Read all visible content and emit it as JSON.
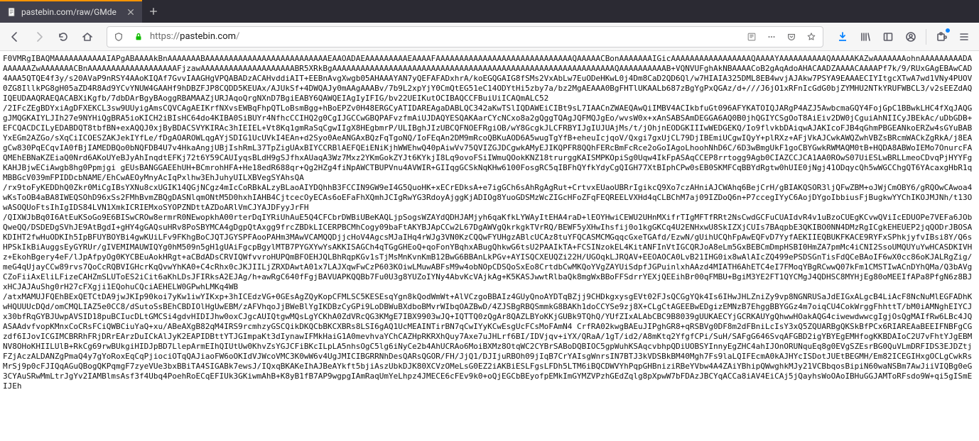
{
  "tab": {
    "title": "pastebin.com/raw/GMde"
  },
  "url": {
    "protocol": "https://",
    "host": "pastebin.com",
    "path": "/"
  },
  "colors": {
    "tab_highlight": "#ff9400",
    "lock_green": "#12bc00",
    "download_blue": "#0a84ff"
  },
  "content": {
    "raw": "F0VMRgIBAQMAAAAAAAAAAAIAPgABAAAAkBnAAAAAAABAAAAAAAAAAAAAAAAAAAAAAAAAAEAAOADAEAAAAAAAAAEAAAAFAAAAAAAAAAAAAAAAAAAAAAAAAAAAAQAAAAACBonAAAAAAAIGicAAAAAAAAAAAAAAAAAQAAAAYAAAAAAAAAAQAAAAAKAZwAAAAAAAohnAAAAAAAAADAAAAAAAZwAAAAAAACBnAAAAAAAAAAAAAAAAAAAFjzawAAAAAAAAAAAAAAAAAAAABR5XRkBgAAAAAAAAAAAAAAAAAAAAAAAAAAAAAAAAAAAAAAAAAAAAAAAAAAAAAAAAAAAAQAAAAAAAAAAB+VQNVUFghAkNBAAAACoB2gAqAdoAHACAADZAAAACAAAAPf7k/9/RUxGAgEBAwCAD4AAA5QTQE4f3y/s20AVaP9nRSY4AAoKIQAf7GvvIAAGHgVPQABADzACAHvddiAIT+EEBnAvgXwgb05AHAAAYAN7yQEFAFADxhrA/koEGQGAIG8fSMs2VxAbLw7EuODeHKwL0j4Dm8CaD2QD6Ql/w7HIAIA325DML8EB4wvjAJAkw7PSYA9EAAAECIYItgcXTwA7wd1VNy4PUOV0ZG8IllkPG8gH05aZD4R8Ad9YCvYNUW4GAAHf9hDBZFJP8CQDD5KEUAx/AJUkSf+4DWQAJy0mAAgAAABv/7b9L2xpYjY0CmQtEG51eC14ODYtHi5zby7a/bz2MgAEAAA0BgFHTlUKAALb687zBgYgPxQGAz/d+///J6jO1xRFnIcGdG0bjZYMHU2NTkYRUFWBCL3/v2sEEZdAQIQEUDAAQRAEQACABXiKgfb/7dbDArBgyBAoggRBAMAAZjURJAqoQrgNXnD7BgiEABY6QAWQEIAgIyIFIG/bv22UEIKutOCIBAQCCFBuiUiICAQmALC52\n/2IFcZEgBDYxiAgDFXEKCL3sw9UUyigAmsCQVCAgAEIKrfNXvsEWBqFhpQTLoBsmBgg+hBoEPZv0H48ERGCyATIDAREAgaDABLQC342aKwTSlIQDAWEiCIBt9sL7IAACnZWAEQAwQiIMBV4ACIkbfuGt096AFYKATOIQJARgP4AZJ5AwbcmaGQY4FojGpC1BBwkLHC4fXqJAQGgJMQGKAIYLJIh27e9NYHiQgBRA5ioKICH2iBIsHC64do4KIBA0SiBUYr4NfhcCCIHQ2g0CgIJGCCwGBQPAFvzfmAiUJDAQYESQAKAarCYcNCxo8a2gQggTQAgJQFMQJgEo/wvsW0x+xAnSABSAmDEGGA6AQ0B0jhQGIYCSgOoT8AiEiv2DW0jCguiAhNIICyJBEkAc/uDbGDB+EFCQACDCILyEDABDQT8tbfBN+exAQQJ0xjByBDACSVYKIRAc3hIEIEL+Vt8Kq1gmRaSqCgwIIgX8HEgbmrP/ULIBghJIzUBCQFNOEFRgiOB/wY8GcgkJLCFRBYIJgIUJUAjMs/t/jOhjnEODGKIIIwWEDGEKQ/Io9flvkbDAiqwAJAKIcoFJB4qGhmPBGEANkoERZw4sGYuBABYxEGm2AZGo/sXqCiICOESZAKJekIYfLe/fDgAOAROWLqgAYjSDIG1UcUVkI4EAn+d2Syo0AeANGAxBQzFqTgoNQ/IoFEqAn2DM9mRcoQBKuAOD6A5wugTgYfB+eheuIcjqoV/Qxgi7gxUjCL79DjIBEmiUCgwIQyY+plRXz+AFjVkAJCwkAWQZwhVBZsBRcmWACkZgRkA/j8EAgCw830PqECqvIA0fBjIAMEDBQo0bNQFDB4U7v4HkaAngjUBjIshRmL37TpZigUAxBIYCCRBlAEFQEiENiKjhWWEhwQ40pAiwVv75QVIZGJDCgwkAMyEJIKQPFR8QQhFERcBmFcRce2oGoIAgoLhoohNhD6C/6D3wBmgUkF1goCBYGwkRWMAQM0tB+HQDA8ABWoIEMo7OnurcFAQMEhEBNaKZEiaQ0Nrd6AKoUYeBJyAhInqdtEFKj72t6Y59CAUIyqsBLdH9gSJfhxAUaqA3Wz7Mxz2YKmGokZYJt6KYkjI8Lq9ovoFSiIWmuQOokKNZ18trurggKAISMPKOpiSg0Uqw4IkFpASAqCCEP8rrtogg9Agb0CIAZCCJCA1AA0ROwS07UiESLwBRLLmeoCDvqPjHYYFgKAHJBjwECiAwgb8hg0Ppmjgi gEUsBANGGAEEhUH+BCmrohHFA+He18edR688qr+Qg2HZg4fiNpAWCTBUPVnu4AVWIR+GIIqgGCSkNqKHw6100FosgRC5qIBFhQYfkYdyCgQIGH77XtBIphCPw0sEB0SKMFCqBBYdRgtw0hUIE0jNgj41ODqycQh5wWGCChgQT6YAcaxgHbR1qMBBGcV039mFPIDDcbNAME/EhCwAEOyMnyAcIqPxlhw3EhJuhyUILXBVegSYAhsQA\n/rx9toFyKEDDhQ0Zkr0MiCgIBsYXNu8cxUGIK14QGjNCgz4mIcCoRBkALzyBLaoAIYDQhhB3FCCIN9GW9eI4G5QuoHK+xECrEDksA+e7igGCh6sAhRgAgRut+CrtvxEUaoUBRrIgikcQ9Xo7czAHniAJCWAhq6BejCrH/gBIAKQSOR3ljQFwZBM+oJWjCmOBY6/gRQOwCAwoa4wKsToOB4aBA8IWEQSOhD96xSs2FMhBvmZBQgDASNlqmONtM5D0hxhIAHB4CjtcecOyECAs6oEFaFhXQmhJCIgRwYG3RdoyAjggKjADIOg8YuoGDSMzWcZIGcHFoZFqFEQREELVXHd4qCLBChM7aj09IZDoQ6n+P7ccegIYyC6AojDYgoIbbiusFjBugkwYYChIKOJMJNh/t13OwASOQUoFtsIhIgIDS84LVN1XmkICRIEMxoSYOPZNDttAZDoARlVmCJYAJDFyyJrFH\n/QIXWJbBq0I6AtEuKSoGo9E6BISwCROw8ermrR0NEwopkhA00rterDqIYRiUhAuE5Q4CFCbrDWBiUBeKAQLjpSogsWZAYdQDHJAMjyh6qaKfkLYWAyItEHA4raD+lEOYHwiCEWU2UHnMXifrTIgMFTfRRt2NsCwdGCFuCUAIdvR4v1uBzoCUEgKCvwQViIcEDUOPe7VEFa6JObQweQQ/DSDEDgSVhJE9AtBgdI+gHY4gGAQsuHRv8PoSBYMCA4gDgpQtAxgg9frcZBDkLICERPBCMhCogy09baFtAKYBJApCCw2L67DgAWVgQkrkgkTVrRQ/BEWF5yXHwIhsfij0o1kgGKCq4U2ENHxwU8SkIZXjCUIs7BAqpbE3QKIBO0NN4DMzRgICgkEHEUEP2jqQODrJBOSAKDIHT2fwHuODKIh5IpBFUYBOYBi4gwKUiLFv9FKhgBoCJQTJGYSPFAooPAHm3MAwVCAMQQDjjcHoV4AgcsMJaIHq4rWJg3VN0KzCQQwFYUHgzABlcUCAz8tuYFQCASMCMGqqcGxeTGAfd/EzwN/gUihUCQhFpAwEQFvD7YyfAEKIIEQBUKFKACE9RYFxSPhkjyfvIBsi8Y/Q6sHPSkIkBiAuggsEyGYRUr/gIVEMIMAUWIQYg0hM509n5gH1gUAiFgcpBgylMTB7PYGXYwYsAKKISAGCh4qTGgGHEoQ+qoFonYBqhxABugQhkwG6tsU2PAAIkTA+FCSINzokEL4KitANFInVtIGCQRJoA8eLm5GxBEBCmDmpHSBI0HmZA7pmMc4iCNI2SsoUMQUYuYwHCASDKIVHz+EkohBgery4eF/lJpAfpyOg0KYCBEuAokHRgt+aCBdADsCRVIQWfvvroHUPQmBFOEHJQLBhRqpKGv1sTjMsMnKvnKmB12BwG6BBAnLkPGv+AYISQCXEUQZi22H/UGOqkLJRQAV+EEOAOCA0LvB21IHG0ix8wAlAIcZQ499ePSDSGnTisFdQCeBAoIF6wX0cc86oKJALRgZig/meG4qUjayCCw89rvs7QoCcRQBVIGHcrKqQvwYhKA0+C4cRhx0cJKJIILjZRXDAwtA01x7LAJXqwFwCzP603KOiwLMuwABFsM9w4obNOpCDSQoSxEo8CrtdbCwMKQoYVgZAYUiSdpfJGPuinlxhAAzd4MIATH6AhETC4eI7FMoqYBgRCwwQ07kFm1CMSTIwACnDYhQMa/Q3bAVgCZoFiiAxEliLFizeCAHZmSLUToES2iCit6aKhLDsJFIRksA2EJAg/h+awRgC640fFgjBAVUAPKQQBb7Fu0U3g8YUZoIYNy4AbvKcVAjkAg+K5KASJwwtRlbaQk8mgWxBBoFFSdrrYEXjQEEihBr00qFMBU+BgiM3YE2FT1QYCMgJ4QDHSC8MYHjEg80oMEEIfAPa8PfgN6z8BJxHCJAJAuShg0rH27cFXgji1EQohuCQciAEHELW0GPwhLMKq4WB\n/atxMAMUJFQEhBExQETCtDA9jwJKIp90koi7yKw1iwYIKxp+3hICEdzVG+0GEsAgZQyKopCFMLSC5KESEsqYgn8kQodWmWt+AlVCzgoBBAIz4GUyQnoAYDTqBZjj9CHDkgxysgEVt02FJsQCGgYQk4Is6IHwJHLZniZy9vp8NGNRUSaJdEIGxALgcB4LiAcF8NcNuMlEGFADhKwHQUUUcDQd/omCMQLIAZ5e0CC8/dSutoSsBEhCBDIOlHgUwEBM/zAFVhqoJjBWeBlYgIKDBzCyGPi9LoDBWuBXdboBMvrWIbqOAZBwD/4ZJSBgRBQSmmkG8BAKh1doCCYSe9zj8X+CLgCtAGEEBwEDgizEMNzB7EhggBBYGGz4m7oiqCU4CokWrggFhhttT/bM0iAMNghEIYCJx30bfRqGYBJUwpAVSID18puBCIucDLtGMCSi4gdvHIDIJhw0oxCJgcAUIQtgwMQsLgYCKhA0ZdVRcQG3KMgE7IBX9903wJQ+IQTTQ0zQgAr8QAZLBYoKKjGUBk9TQhQ/YUfZIxALAbCBC9B8039gUUKAECYjGCRKAUYgQhwwHOakAQG4ciwewdwwcgIgjOsQgMAIfRw6LBc4JQASAAdvfvopKMnxCoCRsFCiQWBCiuYaQ+xu/ABeAXgB82qM4IRS9rcmhzyGSCQikDKQCbBKCXBRs8LSI6gAQ1UcMEAINTirBN7qCwIYyKCwEsgUcFCsMoFAmN4 CrfRA02kwgBAEuJIPghGR8+qRSBVg0DF8m2dFBniLcIsY3xQ5ZQUARBgQKSkBfPCx6RIAREAaBEEIFNBFgCGzdf6IJovICGIMCBRRhFRjDRrEArzDuICkAlJyK2EAPIDBttYTJGImpaKt3dIynawIFMkHaiG1A0mevhvaYChCAZHpRKRXhQuy7Axe7uJHLrf6BI/IDVjqv+iYX/QRaA/1gT/id2/A8mKtq2YfgfCPi/SuH/SAFgG646SvqAFGBD2igYBYEgEMHfogKKBDAIoC2U7vFhtYJgEBMNV8OHoKHIILUlB+RkCg69rwBUkgiHIDJpBD7LlepArmEIhQIUtUw0KhvZsYGJCFiBKcILpLA5nhsOgC5lg6iNyCe2b4AhUCRAo6MoiBXMz8OtqWC2CYBrSABoDQBIOC5gpWuhKSAqcvbhpQDiUOBSYInnyEgZHC4ahIJOnORUNquEq8g0EVgSZEsrBG0QuVLmDRFIDS3EJDZtjFZjAczALDANZgPmaQ4y7gYoRoxEqCqPjiociOTqQAJiaoFW6oOKIdVJWcoVMC3K0wW6v4UgJMICIBGRRNhDesQARsQGOR/FH/JjQ1/DJIjuRBOh09jIqB7CrYAIsgWnrsIN7BTJ3kVDSBkBM40Mgh7Fs9laLQIFEcmA0kAJHYcISDotJUEtBEGMH/Em82ICEGIHxgOCLgCwkRsMrSj9p0cFJIQqAGuQBogQKPqmgF7zyeVUe3bxBBiTA4SIGABk7ewsJ/IQxqBKAKeIhAJBeAYkft5bjiAszUbkDJK80XCVzOMeLsG0EZ2iAKBiESLFgsLFDh5LTM6iBQCDWVYhPqpGHBniziRBeYVbw4A4ZAiYBhipQWwghkMJy21VCBbqosBipiN60waNSBm7AwJiiVIQBg0eG3CYAuSRwMmLtrJgYv2IAMBlmsAsf3f4Ubq4PoehRoECqEFIUk3GKiwmAhB+K8yB1fB7AP9wgpgIAmRaqUmYeLhpz4JMECE6cFEv9k0+oQjEGCbBEyofpEMkImGYMZVPzhGEdZqlg8pXpwW7bFDAzJBCYqACCa8iAV4EiCAj5jQayhsWoOAoIBHuGGJAMToRFsdo9W+qi5gISmEIJEh"
  }
}
